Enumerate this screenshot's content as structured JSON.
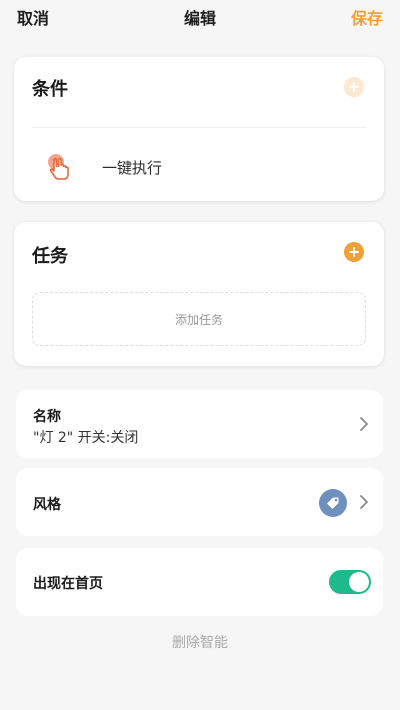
{
  "header": {
    "cancel_label": "取消",
    "title": "编辑",
    "save_label": "保存"
  },
  "condition": {
    "title": "条件",
    "add_icon": "plus-circle-icon",
    "items": [
      {
        "icon": "tap-hand-icon",
        "label": "一键执行"
      }
    ]
  },
  "task": {
    "title": "任务",
    "add_icon": "plus-circle-icon",
    "placeholder": "添加任务"
  },
  "name_row": {
    "title": "名称",
    "value": "\"灯 2\" 开关:关闭",
    "icon": "chevron-right-icon"
  },
  "style_row": {
    "label": "风格",
    "icon": "tag-icon",
    "icon_color": "#6f8fbf"
  },
  "home_row": {
    "label": "出现在首页",
    "toggle_on": true,
    "toggle_color": "#1dba8c"
  },
  "delete_label": "删除智能",
  "colors": {
    "accent": "#f0a037",
    "accent_light": "#fde8d2",
    "background": "#f6f6f6"
  }
}
